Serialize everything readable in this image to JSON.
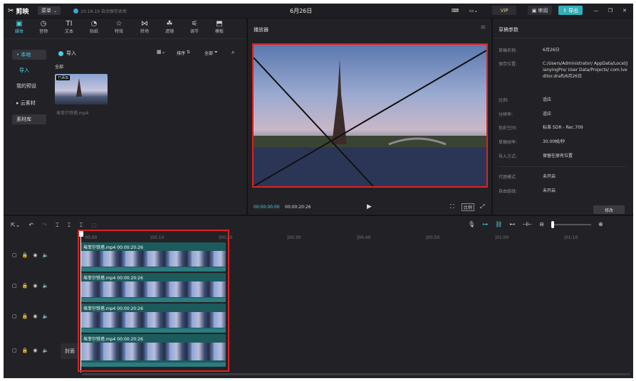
{
  "titlebar": {
    "app_name": "剪映",
    "menu_label": "菜单",
    "autosave": "10:18:19 自动保存本地",
    "title": "6月26日",
    "vip": "VIP",
    "review": "审阅",
    "export": "导出"
  },
  "toolbar": {
    "items": [
      {
        "label": "媒体"
      },
      {
        "label": "音频"
      },
      {
        "label": "文本"
      },
      {
        "label": "贴纸"
      },
      {
        "label": "特效"
      },
      {
        "label": "转场"
      },
      {
        "label": "滤镜"
      },
      {
        "label": "调节"
      },
      {
        "label": "模板"
      }
    ]
  },
  "media": {
    "side": [
      "• 本地",
      "导入",
      "我的预设",
      "▸ 云素材",
      "素材库"
    ],
    "import_label": "导入",
    "sort_label": "排序",
    "filter_label": "全部",
    "all_label": "全部",
    "added_badge": "已添加",
    "file_name": "埃菲尔铁塔.mp4"
  },
  "player": {
    "title": "播放器",
    "current_time": "00:00:00:00",
    "total_time": "00:00:20:26",
    "ratio_btn": "比例"
  },
  "draft": {
    "title": "草稿参数",
    "rows": [
      {
        "k": "草稿名称:",
        "v": "6月26日"
      },
      {
        "k": "保存位置:",
        "v": "C:/Users/Administrator/ AppData/Local/JianyingPro/ User Data/Projects/ com.lveditor.draft/6月26日"
      },
      {
        "k": "比例:",
        "v": "适应"
      },
      {
        "k": "分辨率:",
        "v": "适应"
      },
      {
        "k": "色彩空间:",
        "v": "标准 SDR - Rec.709"
      },
      {
        "k": "草稿帧率:",
        "v": "30.00帧/秒"
      },
      {
        "k": "导入方式:",
        "v": "保留在原有位置"
      },
      {
        "k": "代理模式",
        "v": "未开启"
      },
      {
        "k": "自由层级:",
        "v": "未开启"
      }
    ],
    "edit_btn": "修改"
  },
  "timeline": {
    "ruler": [
      "00:00",
      "|00:10",
      "|00:20",
      "|00:30",
      "|00:40",
      "|00:50",
      "|01:00",
      "|01:10"
    ],
    "clip_label": "埃菲尔铁塔.mp4  00:00:20:26",
    "cover_label": "封面"
  }
}
